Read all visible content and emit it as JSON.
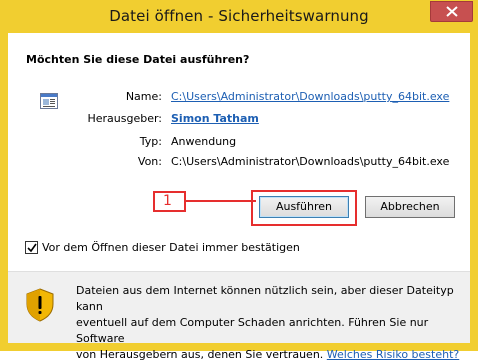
{
  "window": {
    "title": "Datei öffnen - Sicherheitswarnung"
  },
  "dialog": {
    "question": "Möchten Sie diese Datei ausführen?",
    "fields": {
      "name_label": "Name:",
      "name_value": "C:\\Users\\Administrator\\Downloads\\putty_64bit.exe",
      "publisher_label": "Herausgeber:",
      "publisher_value": "Simon Tatham",
      "type_label": "Typ:",
      "type_value": "Anwendung",
      "from_label": "Von:",
      "from_value": "C:\\Users\\Administrator\\Downloads\\putty_64bit.exe"
    },
    "buttons": {
      "run": "Ausführen",
      "cancel": "Abbrechen"
    },
    "checkbox": {
      "label": "Vor dem Öffnen dieser Datei immer bestätigen",
      "checked": true
    },
    "warning": {
      "line1": "Dateien aus dem Internet können nützlich sein, aber dieser Dateityp kann",
      "line2": "eventuell auf dem Computer Schaden anrichten. Führen Sie nur Software",
      "line3": "von Herausgebern aus, denen Sie vertrauen.",
      "link": "Welches Risiko besteht?"
    }
  },
  "annotation": {
    "step": "1",
    "color": "#e62e2e"
  },
  "icons": {
    "close": "close-icon",
    "file": "application-file-icon",
    "shield": "warning-shield-icon",
    "check": "checkmark-icon"
  },
  "colors": {
    "frame": "#f1ce30",
    "link": "#1d5fb3",
    "close": "#c75050"
  }
}
